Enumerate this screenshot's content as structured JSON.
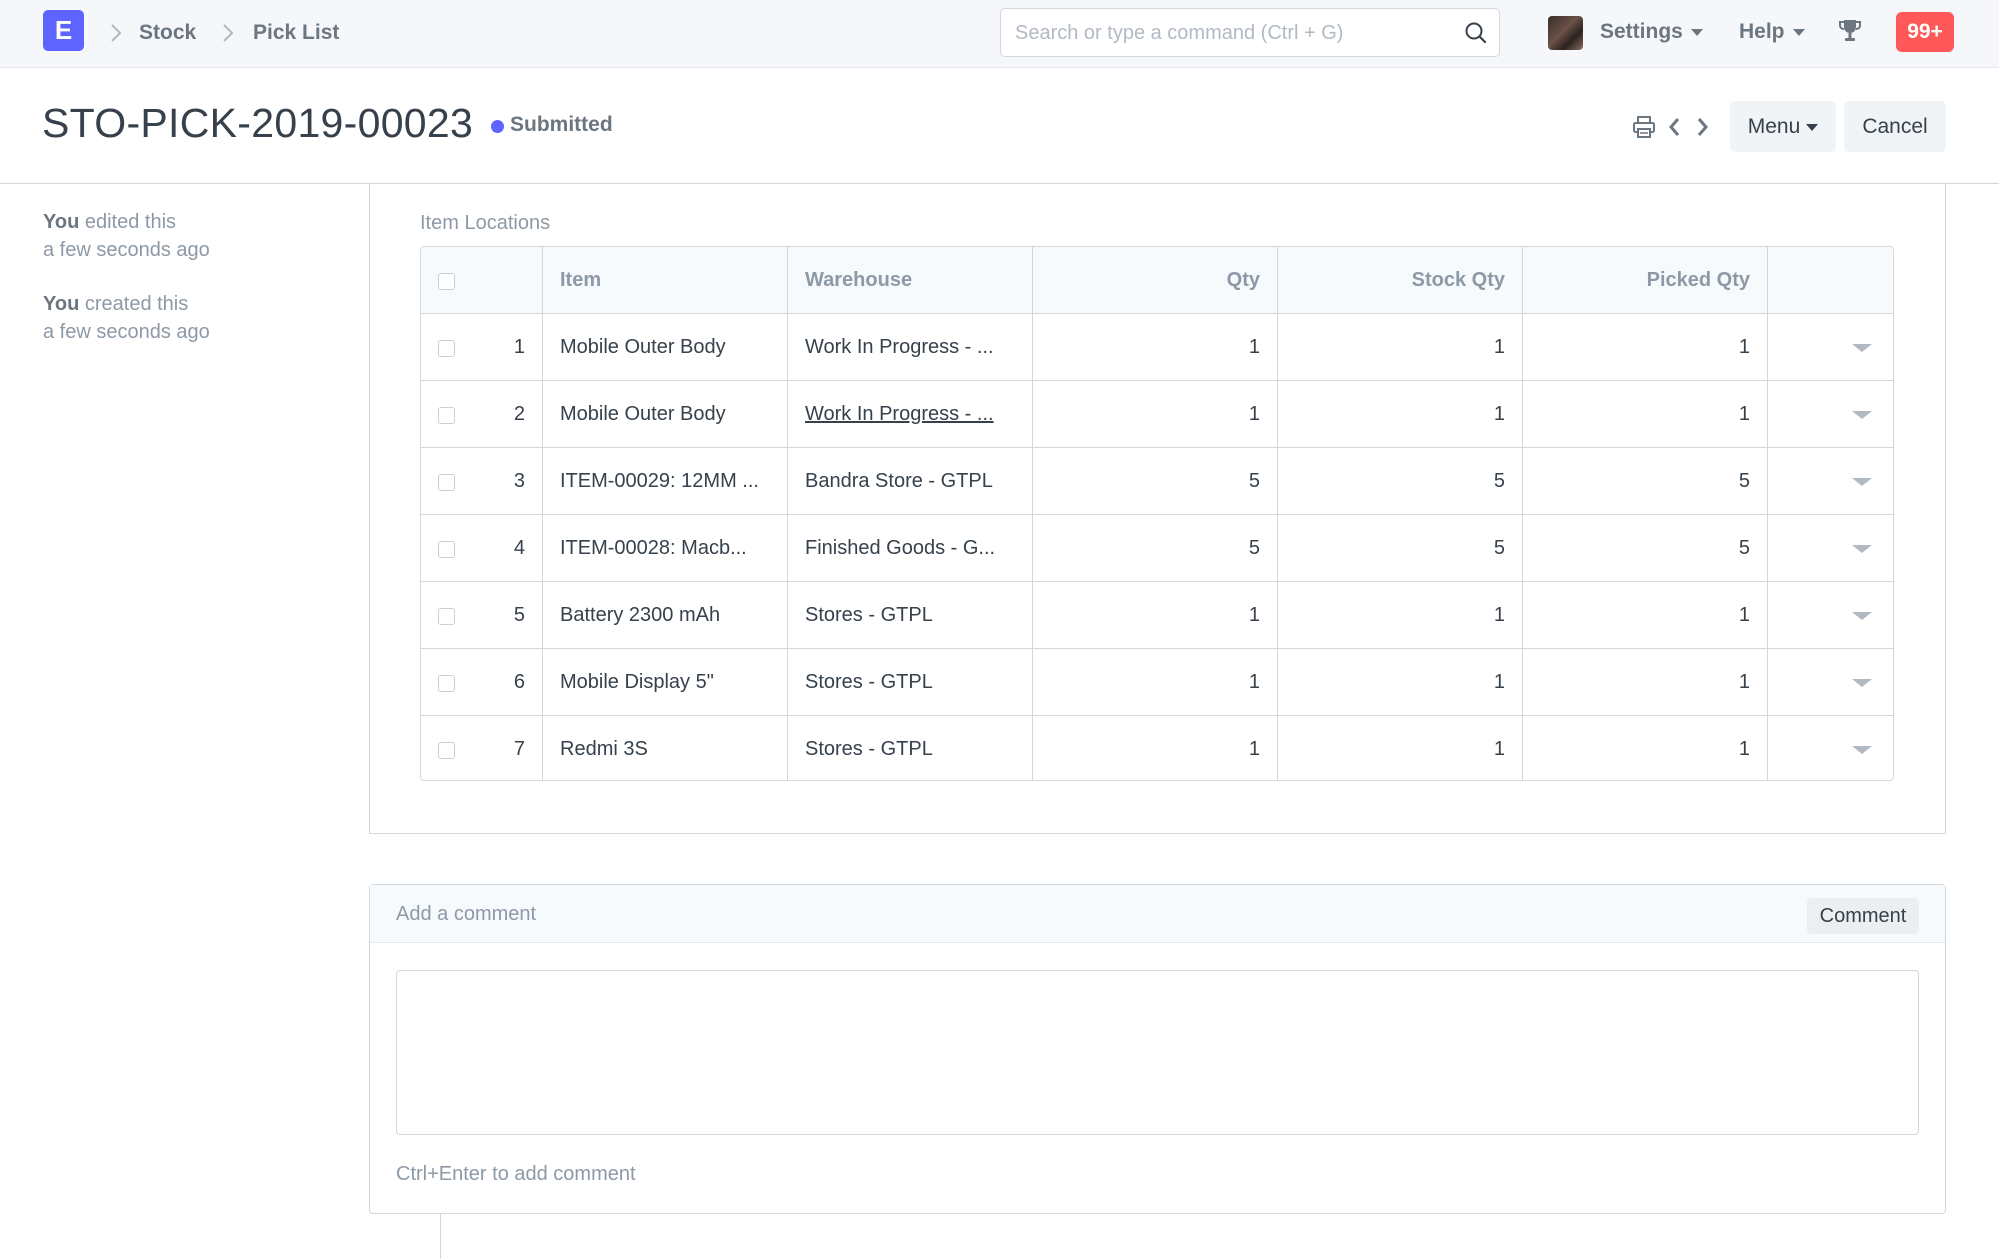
{
  "app": {
    "logo_letter": "E",
    "brand_color": "#5e64ff"
  },
  "breadcrumbs": [
    "Stock",
    "Pick List"
  ],
  "search": {
    "placeholder": "Search or type a command (Ctrl + G)",
    "value": ""
  },
  "navbar": {
    "settings_label": "Settings",
    "help_label": "Help",
    "notifications_count": "99+",
    "notification_color": "#ff5858"
  },
  "doc": {
    "title": "STO-PICK-2019-00023",
    "status": "Submitted",
    "status_color": "#5e64ff"
  },
  "actions": {
    "menu_label": "Menu",
    "cancel_label": "Cancel"
  },
  "activity": [
    {
      "actor": "You",
      "action": "edited this",
      "time": "a few seconds ago"
    },
    {
      "actor": "You",
      "action": "created this",
      "time": "a few seconds ago"
    }
  ],
  "section": {
    "label": "Item Locations"
  },
  "table": {
    "columns": {
      "item": "Item",
      "warehouse": "Warehouse",
      "qty": "Qty",
      "stock_qty": "Stock Qty",
      "picked_qty": "Picked Qty"
    },
    "rows": [
      {
        "idx": "1",
        "item": "Mobile Outer Body",
        "warehouse": "Work In Progress - ...",
        "qty": "1",
        "stock_qty": "1",
        "picked_qty": "1"
      },
      {
        "idx": "2",
        "item": "Mobile Outer Body",
        "warehouse": "Work In Progress - ...",
        "qty": "1",
        "stock_qty": "1",
        "picked_qty": "1"
      },
      {
        "idx": "3",
        "item": "ITEM-00029: 12MM ...",
        "warehouse": "Bandra Store - GTPL",
        "qty": "5",
        "stock_qty": "5",
        "picked_qty": "5"
      },
      {
        "idx": "4",
        "item": "ITEM-00028: Macb...",
        "warehouse": "Finished Goods - G...",
        "qty": "5",
        "stock_qty": "5",
        "picked_qty": "5"
      },
      {
        "idx": "5",
        "item": "Battery 2300 mAh",
        "warehouse": "Stores - GTPL",
        "qty": "1",
        "stock_qty": "1",
        "picked_qty": "1"
      },
      {
        "idx": "6",
        "item": "Mobile Display 5\"",
        "warehouse": "Stores - GTPL",
        "qty": "1",
        "stock_qty": "1",
        "picked_qty": "1"
      },
      {
        "idx": "7",
        "item": "Redmi 3S",
        "warehouse": "Stores - GTPL",
        "qty": "1",
        "stock_qty": "1",
        "picked_qty": "1"
      }
    ]
  },
  "comment": {
    "title": "Add a comment",
    "button_label": "Comment",
    "hint": "Ctrl+Enter to add comment",
    "value": ""
  },
  "icons": {
    "logo": "erpnext-logo-icon",
    "breadcrumb_separator": "chevron-right-icon",
    "search": "search-icon",
    "trophy": "trophy-icon",
    "print": "printer-icon",
    "prev": "chevron-left-icon",
    "next": "chevron-right-icon",
    "row_menu": "caret-down-icon"
  }
}
